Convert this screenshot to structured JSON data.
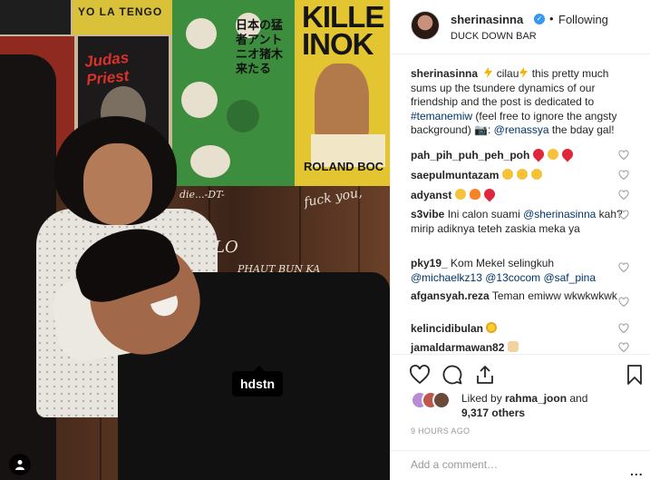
{
  "photo": {
    "tag_label": "hdstn",
    "posters": {
      "judas": "Judas Priest",
      "killer": "KILLE INOK",
      "roland": "ROLAND BOC",
      "yolo": "YO LA TENGO",
      "kanji": "日本の猛者アントニオ猪木来たる"
    },
    "graffiti": {
      "g1": "fuck you,",
      "g2": "LO",
      "g3": "PHAUT BUN KA",
      "g4": "die...-DT-"
    },
    "tags_icon": "user-tag-icon"
  },
  "header": {
    "username": "sherinasinna",
    "follow_status": "Following",
    "location": "DUCK DOWN BAR",
    "verified_icon": "verified-badge-icon",
    "dot": "•"
  },
  "caption": {
    "username": "sherinasinna",
    "text_part1": " cilau",
    "text_part2": " this pretty much sums up the tsundere dynamics of our friendship and the post is dedicated to ",
    "hashtag": "#temanemiw",
    "text_part3": " (feel free to ignore the angsty background) ",
    "camera_emoji": "📷",
    "text_part4": ": ",
    "mention": "@renassya",
    "text_part5": " the bday gal!"
  },
  "comments": [
    {
      "username": "pah_pih_puh_peh_poh",
      "text": ""
    },
    {
      "username": "saepulmuntazam",
      "text": ""
    },
    {
      "username": "adyanst",
      "text": ""
    },
    {
      "username": "s3vibe",
      "text": " Ini calon suami ",
      "mention": "@sherinasinna",
      "text2": " kah?mirip adiknya teteh zaskia meka ya"
    },
    {
      "username": "pky19_",
      "text": " Kom Mekel selingkuh ",
      "mention": "@michaelkz13",
      "text2": " ",
      "mention2": "@13cocom",
      "text3": " ",
      "mention3": "@saf_pina"
    },
    {
      "username": "afgansyah.reza",
      "text": " Teman emiww wkwkwkwk"
    },
    {
      "username": "kelincidibulan",
      "text": ""
    },
    {
      "username": "jamaldarmawan82",
      "text": ""
    }
  ],
  "actions": {
    "like_icon": "heart-icon",
    "comment_icon": "comment-icon",
    "share_icon": "share-icon",
    "save_icon": "bookmark-icon"
  },
  "likes": {
    "prefix": "Liked by ",
    "user": "rahma_joon",
    "middle": " and",
    "count": "9,317 others"
  },
  "timestamp": "9 HOURS AGO",
  "comment_box": {
    "placeholder": "Add a comment…",
    "more": "..."
  },
  "colors": {
    "link": "#003569",
    "verified": "#3897f0",
    "muted": "#999999",
    "border": "#efefef"
  }
}
